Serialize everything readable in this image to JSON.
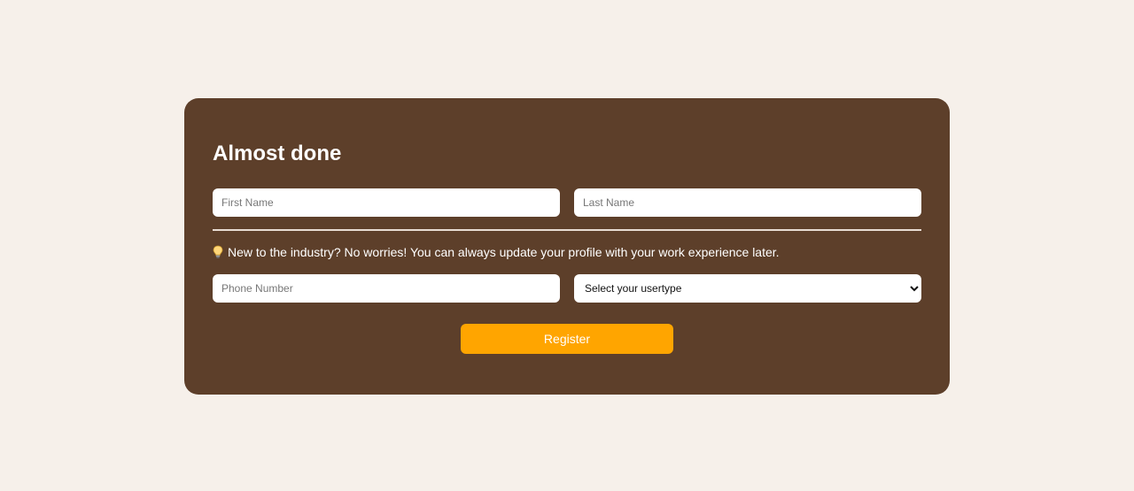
{
  "form": {
    "title": "Almost done",
    "first_name": {
      "placeholder": "First Name",
      "value": ""
    },
    "last_name": {
      "placeholder": "Last Name",
      "value": ""
    },
    "tip": {
      "icon": "lightbulb-icon",
      "text": "New to the industry? No worries! You can always update your profile with your work experience later."
    },
    "phone": {
      "placeholder": "Phone Number",
      "value": ""
    },
    "usertype": {
      "selected": "Select your usertype"
    },
    "register_label": "Register"
  },
  "colors": {
    "page_background": "#f6f0ea",
    "card_background": "#5d3f2a",
    "accent": "#ffa500",
    "text_light": "#ffffff"
  }
}
